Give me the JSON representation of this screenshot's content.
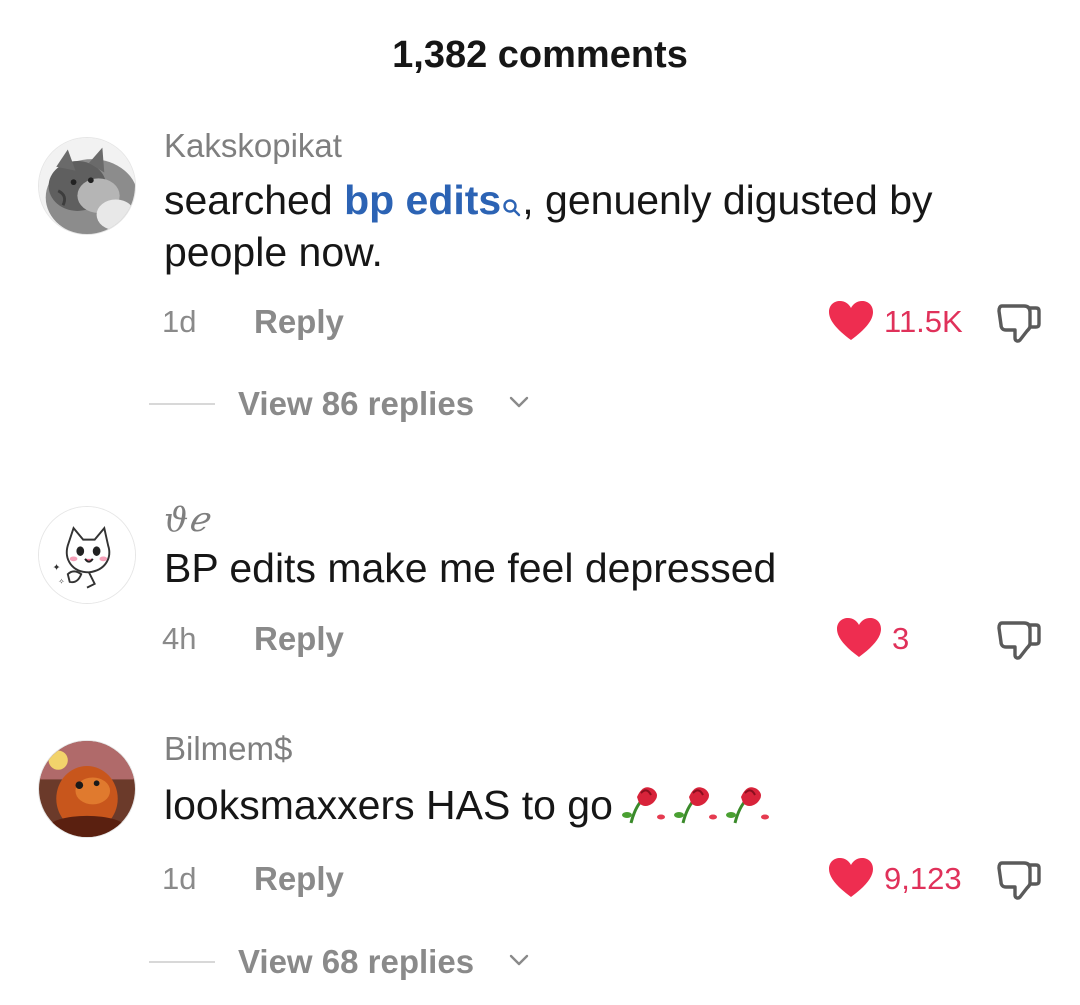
{
  "header": {
    "title": "1,382 comments"
  },
  "comments": [
    {
      "username": "Kakskopikat",
      "text_before": "searched ",
      "search_term": "bp edits",
      "text_after": ", genuenly digusted by",
      "text_line2": "people now.",
      "time": "1d",
      "reply_label": "Reply",
      "likes": "11.5K",
      "replies_label": "View 86 replies"
    },
    {
      "username": "ϑℯ",
      "text": "BP edits make me feel depressed",
      "time": "4h",
      "reply_label": "Reply",
      "likes": "3"
    },
    {
      "username": "Bilmem$",
      "text": "looksmaxxers HAS to go",
      "emoji": "🥀🥀🥀",
      "time": "1d",
      "reply_label": "Reply",
      "likes": "9,123",
      "replies_label": "View 68 replies"
    }
  ],
  "colors": {
    "like": "#e0315a",
    "link": "#2c63b4",
    "muted": "#8a8a8a"
  },
  "icons": {
    "like": "heart-icon",
    "dislike": "thumbs-down-icon",
    "search": "search-icon",
    "expand": "chevron-down-icon"
  }
}
